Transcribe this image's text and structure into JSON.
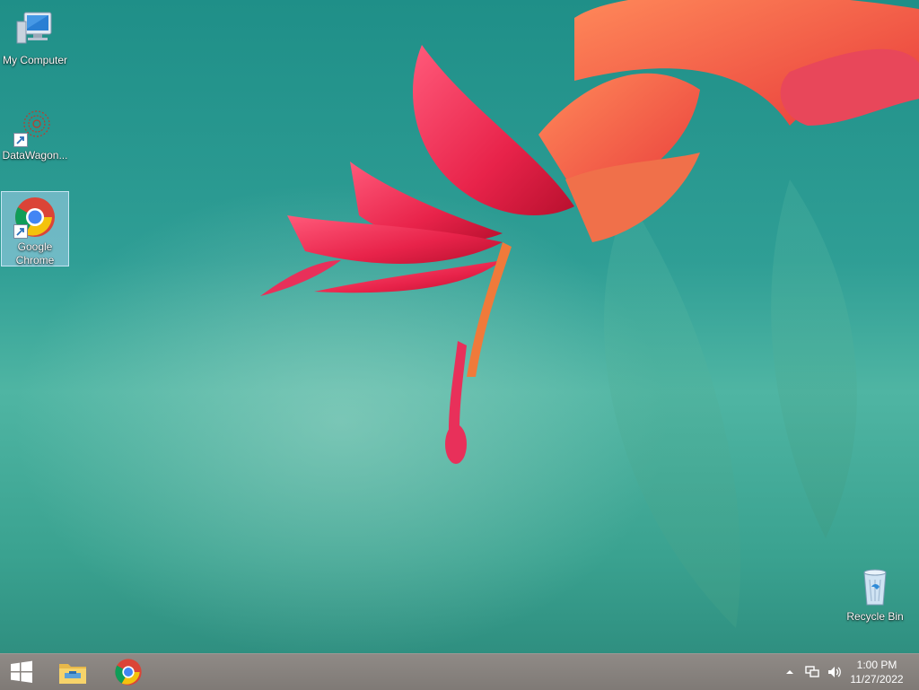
{
  "desktop": {
    "icons": [
      {
        "label": "My Computer"
      },
      {
        "label": "DataWagon..."
      },
      {
        "label": "Google Chrome"
      },
      {
        "label": "Recycle Bin"
      }
    ]
  },
  "taskbar": {
    "pinned": [
      {
        "icon": "start-windows-icon"
      },
      {
        "icon": "file-explorer-icon"
      },
      {
        "icon": "chrome-icon"
      }
    ],
    "tray": {
      "icons": [
        "show-hidden-icons",
        "network-icon",
        "volume-icon"
      ],
      "time": "1:00 PM",
      "date": "11/27/2022"
    }
  },
  "colors": {
    "desktop_bg": "#2f9e95",
    "taskbar_bg": "#8a8581",
    "selection": "#bedcff"
  }
}
